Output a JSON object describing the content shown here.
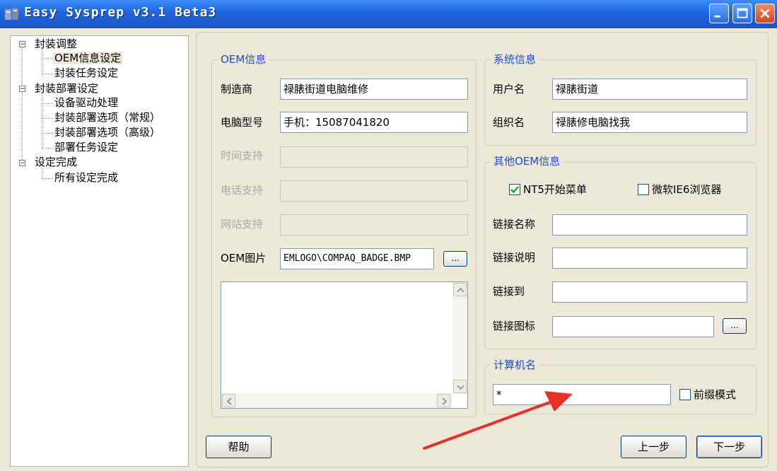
{
  "window": {
    "title": "Easy Sysprep v3.1 Beta3"
  },
  "tree": {
    "expander_collapse": "−",
    "nodes": [
      {
        "label": "封装调整"
      },
      {
        "label": "OEM信息设定"
      },
      {
        "label": "封装任务设定"
      },
      {
        "label": "封装部署设定"
      },
      {
        "label": "设备驱动处理"
      },
      {
        "label": "封装部署选项（常规）"
      },
      {
        "label": "封装部署选项（高级）"
      },
      {
        "label": "部署任务设定"
      },
      {
        "label": "设定完成"
      },
      {
        "label": "所有设定完成"
      }
    ]
  },
  "oem": {
    "title": "OEM信息",
    "manufacturer_label": "制造商",
    "manufacturer_value": "禄脿街道电脑维修",
    "model_label": "电脑型号",
    "model_value": "手机：15087041820",
    "time_support_label": "时间支持",
    "phone_support_label": "电话支持",
    "web_support_label": "网站支持",
    "picture_label": "OEM图片",
    "picture_value": "EMLOGO\\COMPAQ_BADGE.BMP",
    "browse_label": "..."
  },
  "system": {
    "title": "系统信息",
    "user_label": "用户名",
    "user_value": "禄脿街道",
    "org_label": "组织名",
    "org_value": "禄脿修电脑找我"
  },
  "other_oem": {
    "title": "其他OEM信息",
    "nt5_label": "NT5开始菜单",
    "nt5_checked": true,
    "ie6_label": "微软IE6浏览器",
    "ie6_checked": false,
    "link_name_label": "链接名称",
    "link_desc_label": "链接说明",
    "link_to_label": "链接到",
    "link_icon_label": "链接图标",
    "browse_label": "..."
  },
  "computer": {
    "title": "计算机名",
    "value": "*",
    "prefix_label": "前缀模式",
    "prefix_checked": false
  },
  "buttons": {
    "help": "帮助",
    "prev": "上一步",
    "next": "下一步"
  },
  "colors": {
    "titlebar": "#1f64df",
    "group_title": "#1c4bd4",
    "annotation_arrow": "#e8302a"
  }
}
